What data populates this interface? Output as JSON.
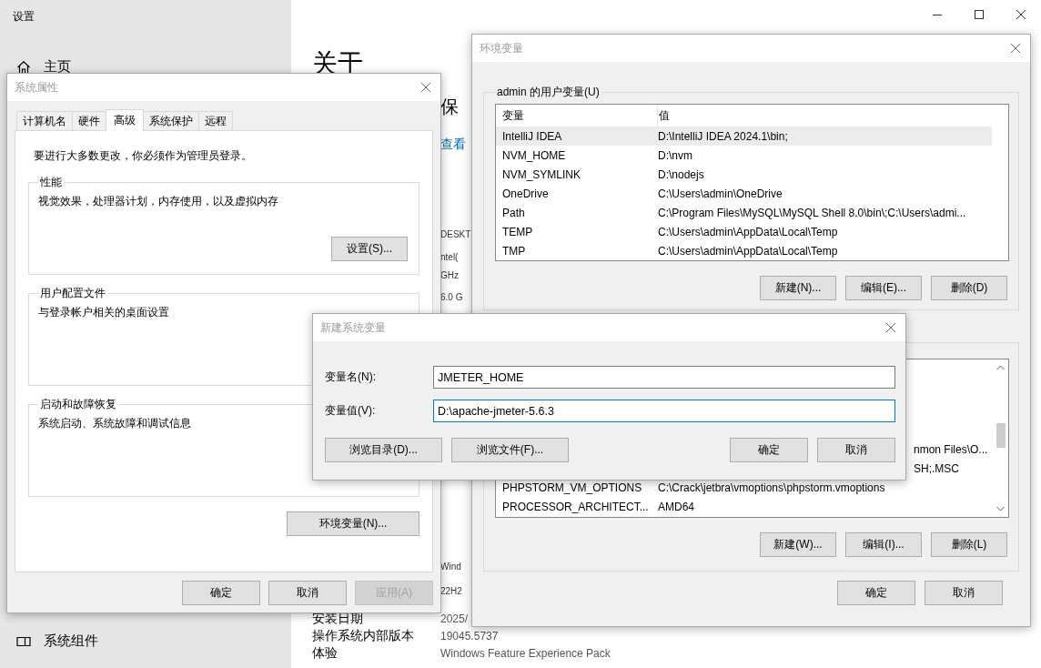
{
  "settings": {
    "title": "设置",
    "nav": [
      {
        "label": "主页"
      },
      {
        "label": "系统组件"
      }
    ],
    "heading": "关于",
    "fragments": [
      {
        "text": "保",
        "kind": "heading"
      },
      {
        "text": "查看",
        "kind": "link"
      },
      {
        "text": "DESKT",
        "kind": "text"
      },
      {
        "text": "ntel(",
        "kind": "text"
      },
      {
        "text": "GHz",
        "kind": "text"
      },
      {
        "text": "6.0 G",
        "kind": "text"
      },
      {
        "text": "Wind",
        "kind": "text"
      },
      {
        "text": "22H2",
        "kind": "text"
      }
    ],
    "info_rows": [
      {
        "label": "安装日期",
        "value": "2025/"
      },
      {
        "label": "操作系统内部版本",
        "value": "19045.5737"
      },
      {
        "label": "体验",
        "value": "Windows Feature Experience Pack"
      }
    ]
  },
  "system_properties": {
    "title": "系统属性",
    "tabs": [
      {
        "label": "计算机名",
        "selected": false
      },
      {
        "label": "硬件",
        "selected": false
      },
      {
        "label": "高级",
        "selected": true
      },
      {
        "label": "系统保护",
        "selected": false
      },
      {
        "label": "远程",
        "selected": false
      }
    ],
    "note": "要进行大多数更改，你必须作为管理员登录。",
    "groups": [
      {
        "title": "性能",
        "text": "视觉效果，处理器计划，内存使用，以及虚拟内存",
        "button": "设置(S)..."
      },
      {
        "title": "用户配置文件",
        "text": "与登录帐户相关的桌面设置"
      },
      {
        "title": "启动和故障恢复",
        "text": "系统启动、系统故障和调试信息"
      }
    ],
    "env_button": "环境变量(N)...",
    "buttons": [
      {
        "label": "确定",
        "disabled": false
      },
      {
        "label": "取消",
        "disabled": false
      },
      {
        "label": "应用(A)",
        "disabled": true
      }
    ]
  },
  "environment_variables": {
    "title": "环境变量",
    "user_group": "admin 的用户变量(U)",
    "columns": [
      "变量",
      "值"
    ],
    "user_rows": [
      {
        "name": "IntelliJ IDEA",
        "value": "D:\\IntelliJ IDEA 2024.1\\bin;",
        "selected": true
      },
      {
        "name": "NVM_HOME",
        "value": "D:\\nvm",
        "selected": false
      },
      {
        "name": "NVM_SYMLINK",
        "value": "D:\\nodejs",
        "selected": false
      },
      {
        "name": "OneDrive",
        "value": "C:\\Users\\admin\\OneDrive",
        "selected": false
      },
      {
        "name": "Path",
        "value": "C:\\Program Files\\MySQL\\MySQL Shell 8.0\\bin\\;C:\\Users\\admi...",
        "selected": false
      },
      {
        "name": "TEMP",
        "value": "C:\\Users\\admin\\AppData\\Local\\Temp",
        "selected": false
      },
      {
        "name": "TMP",
        "value": "C:\\Users\\admin\\AppData\\Local\\Temp",
        "selected": false
      }
    ],
    "user_buttons": [
      "新建(N)...",
      "编辑(E)...",
      "删除(D)"
    ],
    "system_rows": [
      {
        "value": "nmon Files\\O...",
        "partial": true
      },
      {
        "value": "SH;.MSC",
        "partial": true
      },
      {
        "name": "PHPSTORM_VM_OPTIONS",
        "value": "C:\\Crack\\jetbra\\vmoptions\\phpstorm.vmoptions",
        "partial": false
      },
      {
        "name": "PROCESSOR_ARCHITECT...",
        "value": "AMD64",
        "partial": false
      }
    ],
    "system_buttons": [
      "新建(W)...",
      "编辑(I)...",
      "删除(L)"
    ],
    "buttons": [
      "确定",
      "取消"
    ]
  },
  "new_variable": {
    "title": "新建系统变量",
    "fields": [
      {
        "label": "变量名(N):",
        "value": "JMETER_HOME",
        "focused": false
      },
      {
        "label": "变量值(V):",
        "value": "D:\\apache-jmeter-5.6.3",
        "focused": true
      }
    ],
    "left_buttons": [
      "浏览目录(D)...",
      "浏览文件(F)..."
    ],
    "right_buttons": [
      "确定",
      "取消"
    ]
  }
}
